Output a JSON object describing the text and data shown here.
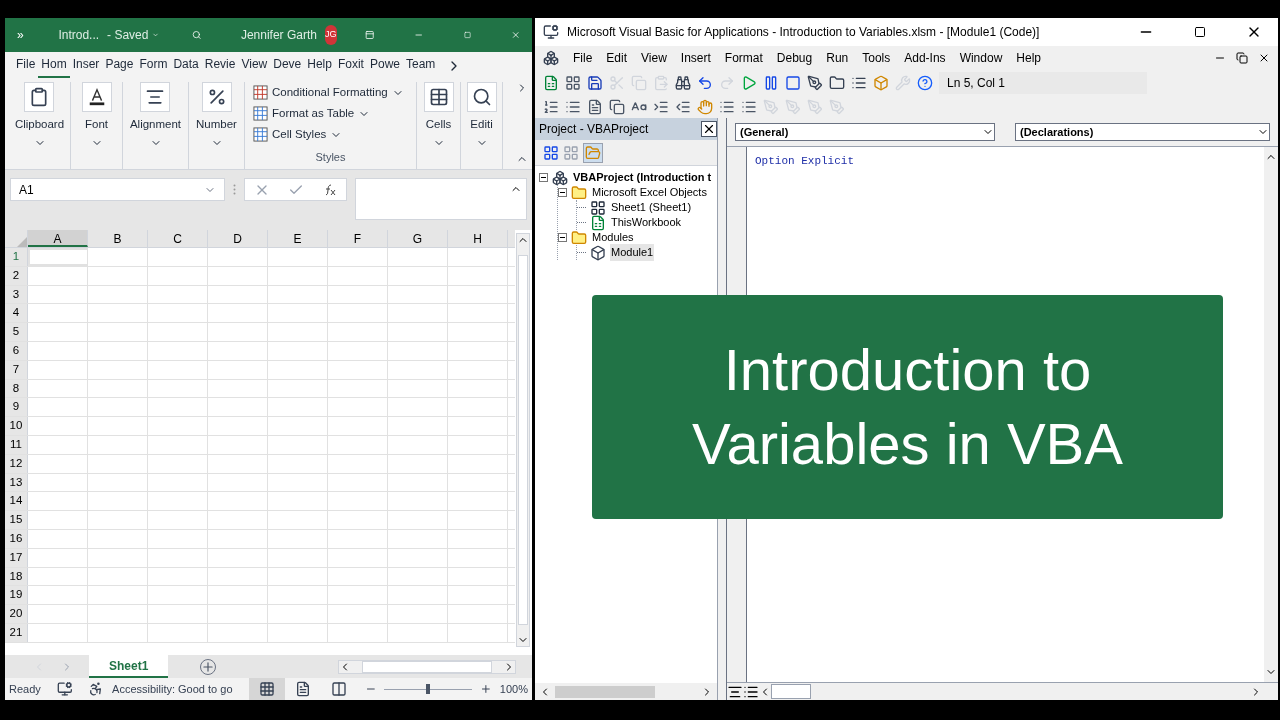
{
  "excel": {
    "title_bar": {
      "expand": "»",
      "file": "Introd...",
      "status": "- Saved",
      "user": "Jennifer Garth",
      "initials": "JG"
    },
    "ribbon_tabs": [
      {
        "label": "File",
        "selected": false
      },
      {
        "label": "Hom",
        "selected": true
      },
      {
        "label": "Inser",
        "selected": false
      },
      {
        "label": "Page",
        "selected": false
      },
      {
        "label": "Form",
        "selected": false
      },
      {
        "label": "Data",
        "selected": false
      },
      {
        "label": "Revie",
        "selected": false
      },
      {
        "label": "View",
        "selected": false
      },
      {
        "label": "Deve",
        "selected": false
      },
      {
        "label": "Help",
        "selected": false
      },
      {
        "label": "Foxit",
        "selected": false
      },
      {
        "label": "Powe",
        "selected": false
      },
      {
        "label": "Team",
        "selected": false
      }
    ],
    "ribbon_groups": [
      {
        "label": "Clipboard",
        "kind": "clipboard"
      },
      {
        "label": "Font",
        "kind": "font"
      },
      {
        "label": "Alignment",
        "kind": "alignment"
      },
      {
        "label": "Number",
        "kind": "number"
      },
      {
        "label": "Styles",
        "kind": "styles",
        "items": [
          "Conditional Formatting",
          "Format as Table",
          "Cell Styles"
        ]
      },
      {
        "label": "Cells",
        "kind": "cells"
      },
      {
        "label": "Editi",
        "kind": "editing"
      }
    ],
    "name_box": "A1",
    "columns": [
      "A",
      "B",
      "C",
      "D",
      "E",
      "F",
      "G",
      "H"
    ],
    "rows": [
      "1",
      "2",
      "3",
      "4",
      "5",
      "6",
      "7",
      "8",
      "9",
      "10",
      "11",
      "12",
      "13",
      "14",
      "15",
      "16",
      "17",
      "18",
      "19",
      "20",
      "21"
    ],
    "sheet_tabs": [
      {
        "label": "Sheet1",
        "selected": true
      }
    ],
    "status_bar": {
      "status": "Ready",
      "accessibility": "Accessibility: Good to go",
      "views": [
        {
          "kind": "normal",
          "selected": true
        },
        {
          "kind": "page-layout",
          "selected": false
        },
        {
          "kind": "page-break",
          "selected": false
        }
      ],
      "zoom": "100%",
      "zoom_slider": {
        "level": 0.5
      }
    }
  },
  "vba": {
    "title": "Microsoft Visual Basic for Applications - Introduction to Variables.xlsm - [Module1 (Code)]",
    "menu": [
      "File",
      "Edit",
      "View",
      "Insert",
      "Format",
      "Debug",
      "Run",
      "Tools",
      "Add-Ins",
      "Window",
      "Help"
    ],
    "position": "Ln 5, Col 1",
    "project": {
      "title": "Project - VBAProject",
      "tree": [
        {
          "label": "VBAProject (Introduction t",
          "kind": "project",
          "expanded": true,
          "selected": false,
          "children": [
            {
              "label": "Microsoft Excel Objects",
              "kind": "folder",
              "expanded": true,
              "selected": false,
              "children": [
                {
                  "label": "Sheet1 (Sheet1)",
                  "kind": "sheet",
                  "selected": false
                },
                {
                  "label": "ThisWorkbook",
                  "kind": "workbook",
                  "selected": false
                }
              ]
            },
            {
              "label": "Modules",
              "kind": "folder",
              "expanded": true,
              "selected": false,
              "children": [
                {
                  "label": "Module1",
                  "kind": "module",
                  "selected": true
                }
              ]
            }
          ]
        }
      ]
    },
    "object_box": "(General)",
    "procedure_box": "(Declarations)",
    "code": [
      "Option Explicit"
    ],
    "overlay": {
      "title": "Introduction to Variables in VBA"
    }
  }
}
